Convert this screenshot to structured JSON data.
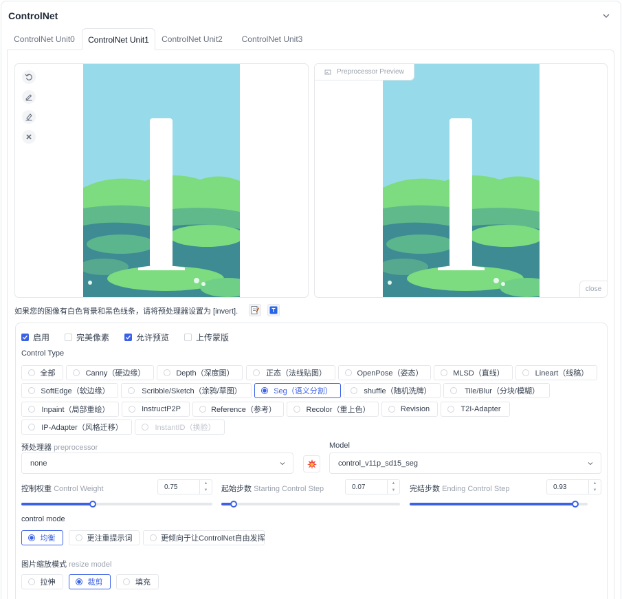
{
  "panel": {
    "title": "ControlNet"
  },
  "tabs": [
    {
      "label": "ControlNet Unit0",
      "active": false
    },
    {
      "label": "ControlNet Unit1",
      "active": true
    },
    {
      "label": "ControlNet Unit2",
      "active": false
    },
    {
      "label": "ControlNet Unit3",
      "active": false
    }
  ],
  "input_image": {
    "tools": [
      "undo-icon",
      "brush-icon",
      "eraser-icon",
      "clear-icon"
    ]
  },
  "preview": {
    "label": "Preprocessor Preview",
    "close_label": "close"
  },
  "hint": {
    "text": "如果您的图像有白色背景和黑色线条，请将预处理器设置为 [invert]."
  },
  "options": {
    "enable": {
      "label": "启用",
      "checked": true
    },
    "pixel_perfect": {
      "label": "完美像素",
      "checked": false
    },
    "allow_preview": {
      "label": "允许预览",
      "checked": true
    },
    "upload_mask": {
      "label": "上传蒙版",
      "checked": false
    }
  },
  "control_type": {
    "label": "Control Type",
    "rows": [
      [
        "全部",
        "Canny（硬边缘）",
        "Depth（深度图）",
        "正态（法线贴图）",
        "OpenPose（姿态）",
        "MLSD（直线）",
        "Lineart（线稿）"
      ],
      [
        "SoftEdge（软边缘）",
        "Scribble/Sketch（涂鸦/草图）",
        "Seg（语义分割）",
        "shuffle（随机洗牌）",
        "Tile/Blur（分块/模糊）"
      ],
      [
        "Inpaint（局部重绘）",
        "InstructP2P",
        "Reference（参考）",
        "Recolor（重上色）",
        "Revision",
        "T2I-Adapter"
      ],
      [
        "IP-Adapter（风格迁移）",
        "InstantID（换脸）"
      ]
    ],
    "selected": "Seg（语义分割）",
    "disabled": "InstantID（换脸）"
  },
  "preprocessor": {
    "label": "预处理器",
    "sub": "preprocessor",
    "value": "none"
  },
  "model": {
    "label": "Model",
    "value": "control_v11p_sd15_seg"
  },
  "control_weight": {
    "label": "控制权重",
    "sub": "Control Weight",
    "value": "0.75",
    "fraction": 0.375
  },
  "starting_step": {
    "label": "起始步数",
    "sub": "Starting Control Step",
    "value": "0.07",
    "fraction": 0.07
  },
  "ending_step": {
    "label": "完结步数",
    "sub": "Ending Control Step",
    "value": "0.93",
    "fraction": 0.93
  },
  "control_mode": {
    "label": "control mode",
    "options": [
      "均衡",
      "更注重提示词",
      "更倾向于让ControlNet自由发挥"
    ],
    "selected": "均衡"
  },
  "resize_mode": {
    "label": "图片缩放模式",
    "sub": "resize model",
    "options": [
      "拉伸",
      "裁剪",
      "填充"
    ],
    "selected": "裁剪"
  },
  "colors": {
    "accent": "#3b62e6",
    "sky": "#97dbea",
    "grass": "#7ddc80",
    "water": "#3e8b94"
  }
}
